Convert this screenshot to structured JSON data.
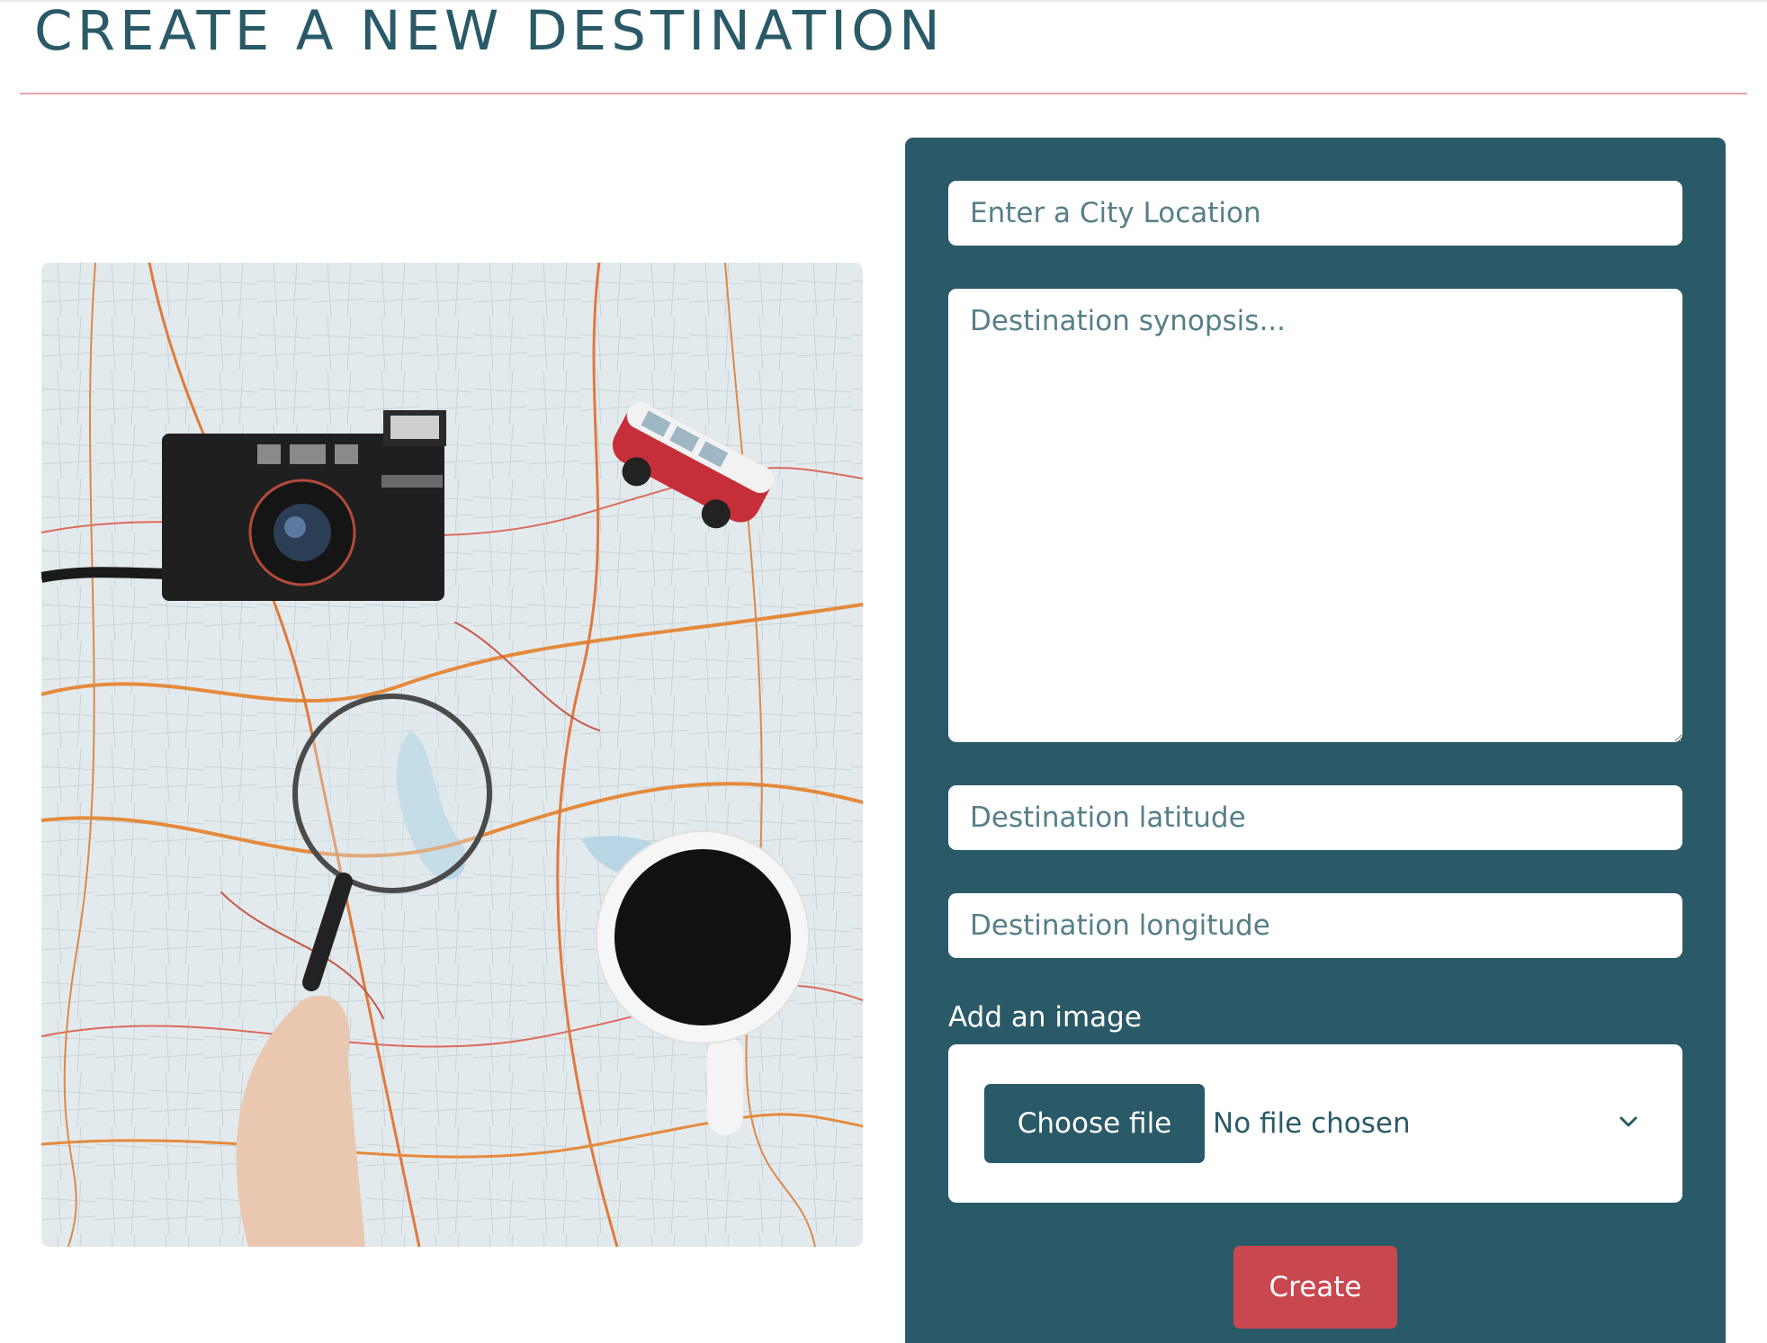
{
  "page": {
    "title": "CREATE A NEW DESTINATION"
  },
  "colors": {
    "brand": "#2a5a67",
    "accent": "#c9474f",
    "divider": "#e8a3a8"
  },
  "hero_image": {
    "icon": "map-camera-van-coffee-photo"
  },
  "form": {
    "city_placeholder": "Enter a City Location",
    "city_value": "",
    "synopsis_placeholder": "Destination synopsis...",
    "synopsis_value": "",
    "latitude_placeholder": "Destination latitude",
    "latitude_value": "",
    "longitude_placeholder": "Destination longitude",
    "longitude_value": "",
    "image_label": "Add an image",
    "choose_file_label": "Choose file",
    "no_file_text": "No file chosen",
    "create_label": "Create"
  }
}
